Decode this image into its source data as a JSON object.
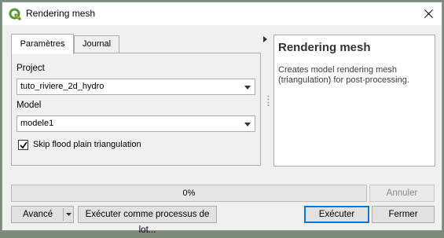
{
  "window": {
    "title": "Rendering mesh",
    "app_icon": "qgis-icon",
    "close_icon": "close-icon"
  },
  "tabs": [
    {
      "label": "Paramètres",
      "active": true
    },
    {
      "label": "Journal",
      "active": false
    }
  ],
  "params": {
    "project_label": "Project",
    "project_value": "tuto_riviere_2d_hydro",
    "model_label": "Model",
    "model_value": "modele1",
    "skip_flood_label": "Skip flood plain triangulation",
    "skip_flood_checked": true
  },
  "help": {
    "title": "Rendering mesh",
    "description": "Creates model rendering mesh (triangulation) for post-processing."
  },
  "progress": {
    "value": 0,
    "text": "0%"
  },
  "buttons": {
    "cancel": "Annuler",
    "advanced": "Avancé",
    "batch": "Exécuter comme processus de lot...",
    "run": "Exécuter",
    "close": "Fermer"
  },
  "colors": {
    "accent": "#0078d7",
    "progress_fill": "#06b025",
    "qgis_green": "#589632",
    "qgis_yellow": "#eeb523"
  }
}
